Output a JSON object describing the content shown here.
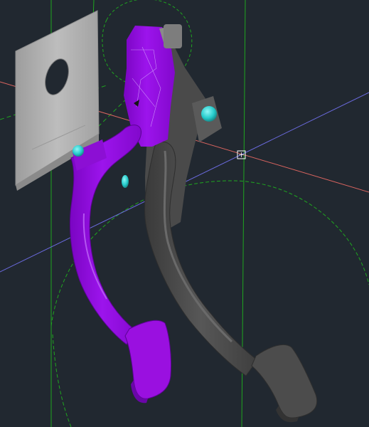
{
  "viewport": {
    "background_color": "#212830",
    "view_mode": "3d-shaded",
    "has_text": false
  },
  "colors": {
    "construction_line": "#1fa61f",
    "x_axis": "#d9645f",
    "y_axis": "#6b6be0",
    "selected_part": "#9a10e0",
    "pedal_part": "#4a4a4a",
    "mounting_plate": "#aeaeae",
    "pin": "#29d1d1",
    "pivot_marker": "#ffffff"
  },
  "objects": [
    {
      "name": "mounting-plate",
      "state": "normal"
    },
    {
      "name": "clutch-pedal-arm",
      "state": "selected"
    },
    {
      "name": "brake-pedal-arm",
      "state": "normal"
    },
    {
      "name": "pivot-pin-upper",
      "state": "normal"
    },
    {
      "name": "pivot-pin-left",
      "state": "normal"
    },
    {
      "name": "pivot-pin-middle",
      "state": "normal"
    }
  ]
}
